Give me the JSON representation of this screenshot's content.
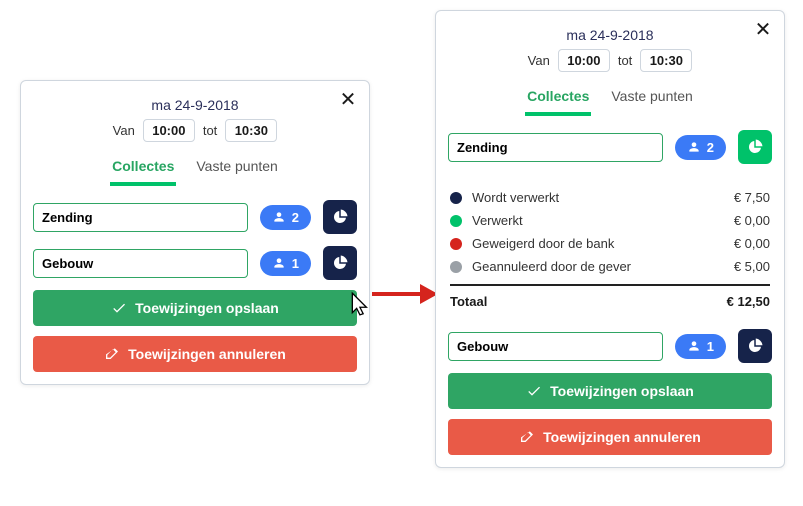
{
  "date_label": "ma 24-9-2018",
  "time": {
    "from_label": "Van",
    "to_label": "tot",
    "from": "10:00",
    "to": "10:30"
  },
  "tabs": {
    "collectes": "Collectes",
    "vaste": "Vaste punten"
  },
  "buttons": {
    "save": "Toewijzingen opslaan",
    "cancel": "Toewijzingen annuleren"
  },
  "left": {
    "items": [
      {
        "name": "Zending",
        "count": "2"
      },
      {
        "name": "Gebouw",
        "count": "1"
      }
    ]
  },
  "right": {
    "items": [
      {
        "name": "Zending",
        "count": "2"
      },
      {
        "name": "Gebouw",
        "count": "1"
      }
    ],
    "breakdown": {
      "currency": "€",
      "rows": [
        {
          "color": "#16234a",
          "label": "Wordt verwerkt",
          "value": "€ 7,50"
        },
        {
          "color": "#00c26a",
          "label": "Verwerkt",
          "value": "€ 0,00"
        },
        {
          "color": "#d5241d",
          "label": "Geweigerd door de bank",
          "value": "€ 0,00"
        },
        {
          "color": "#9aa0a6",
          "label": "Geannuleerd door de gever",
          "value": "€ 5,00"
        }
      ],
      "total_label": "Totaal",
      "total_value": "€ 12,50"
    }
  }
}
